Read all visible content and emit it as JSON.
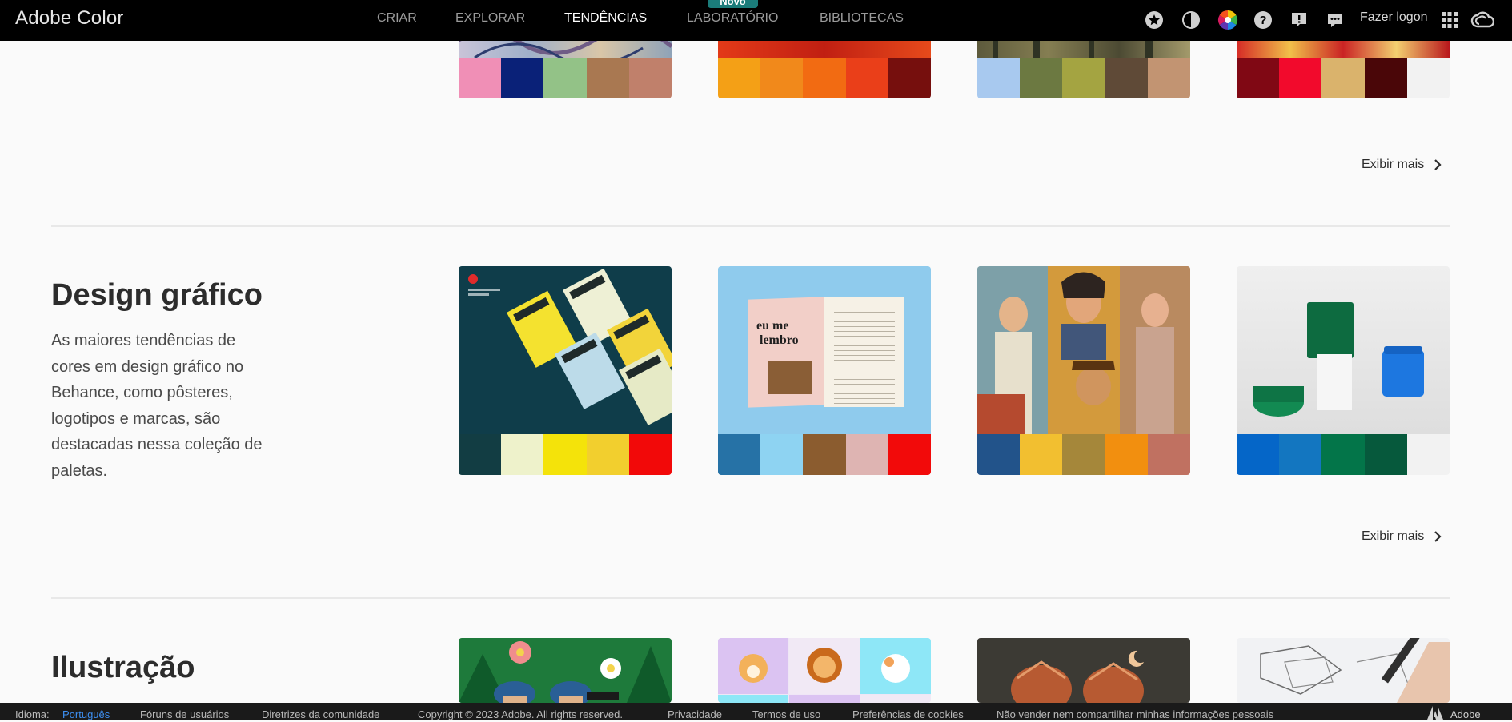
{
  "header": {
    "brand": "Adobe Color",
    "nav": [
      {
        "label": "CRIAR"
      },
      {
        "label": "EXPLORAR"
      },
      {
        "label": "TENDÊNCIAS"
      },
      {
        "label": "LABORATÓRIO"
      },
      {
        "label": "BIBLIOTECAS"
      }
    ],
    "novo_badge": "Novo",
    "login": "Fazer logon",
    "icons": [
      "star-icon",
      "moon-icon",
      "color-wheel-icon",
      "help-icon",
      "alert-icon",
      "chat-icon",
      "apps-grid-icon",
      "creative-cloud-icon"
    ]
  },
  "sections": {
    "top": {
      "palettes": [
        [
          "#f08fb6",
          "#0a2178",
          "#93c287",
          "#a97851",
          "#c0806b"
        ],
        [
          "#f4a016",
          "#f1891b",
          "#f26b12",
          "#ea3f19",
          "#760f0d"
        ],
        [
          "#a8c9ef",
          "#6c7941",
          "#a4a441",
          "#5f4a37",
          "#c29472"
        ],
        [
          "#800814",
          "#f20a2c",
          "#dab36c",
          "#4a0608",
          "#f2f2f2"
        ]
      ],
      "more": "Exibir mais"
    },
    "design": {
      "title": "Design gráfico",
      "description": "As maiores tendências de cores em design gráfico no Behance, como pôsteres, logotipos e marcas, são destacadas nessa coleção de paletas.",
      "palettes": [
        [
          "#123d43",
          "#eef2cb",
          "#f4e30a",
          "#f2cf2e",
          "#f20909"
        ],
        [
          "#2672a6",
          "#8ed3f2",
          "#8b5c2f",
          "#deb4b2",
          "#f20a0a"
        ],
        [
          "#22538a",
          "#f2bf30",
          "#a5873a",
          "#f28f0f",
          "#c07161"
        ],
        [
          "#0566c8",
          "#1376c0",
          "#037549",
          "#06593c",
          "#f2f2f2"
        ]
      ],
      "card2_text": [
        "eu me",
        "lembro"
      ],
      "more": "Exibir mais"
    },
    "illustration": {
      "title": "Ilustração"
    }
  },
  "footer": {
    "language_label": "Idioma:",
    "language_value": "Português",
    "links": [
      "Fóruns de usuários",
      "Diretrizes da comunidade",
      "Copyright © 2023 Adobe. All rights reserved.",
      "Privacidade",
      "Termos de uso",
      "Preferências de cookies",
      "Não vender nem compartilhar minhas informações pessoais"
    ],
    "adobe": "Adobe"
  }
}
